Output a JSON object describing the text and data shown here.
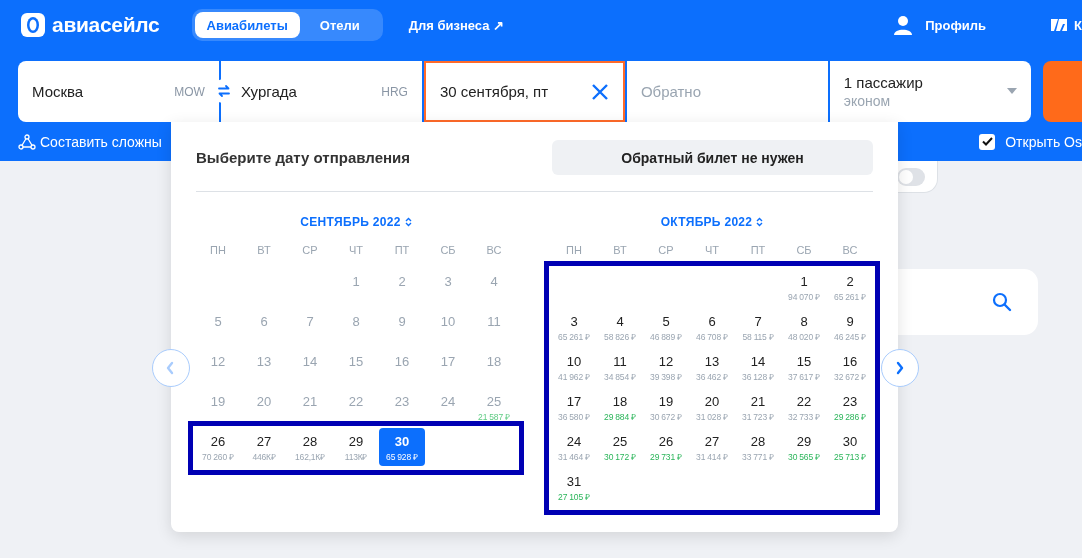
{
  "header": {
    "logo": "авиасейлс",
    "tabs": [
      {
        "label": "Авиабилеты",
        "selected": true
      },
      {
        "label": "Отели",
        "selected": false
      }
    ],
    "business_link": "Для бизнеса ↗",
    "profile": "Профиль",
    "cut_link": "К"
  },
  "search": {
    "origin": {
      "city": "Москва",
      "code": "MOW"
    },
    "destination": {
      "city": "Хургада",
      "code": "HRG"
    },
    "depart": {
      "value": "30 сентября, пт"
    },
    "return": {
      "placeholder": "Обратно"
    },
    "passengers": {
      "count": "1 пассажир",
      "class": "эконом"
    }
  },
  "options": {
    "complex_route": "Составить сложны",
    "open_checkbox": {
      "label": "Открыть Os",
      "checked": true
    }
  },
  "background": {
    "toggle": {
      "on": false
    }
  },
  "picker": {
    "title": "Выберите дату отправления",
    "no_return_button": "Обратный билет не нужен",
    "prev_button": {
      "disabled": true
    },
    "next_button": {
      "disabled": false
    },
    "months": [
      {
        "title": "СЕНТЯБРЬ 2022",
        "weekdays": [
          "ПН",
          "ВТ",
          "СР",
          "ЧТ",
          "ПТ",
          "СБ",
          "ВС"
        ],
        "weeks": [
          {
            "highlighted": false,
            "days": [
              {
                "kind": "blank"
              },
              {
                "kind": "blank"
              },
              {
                "kind": "blank"
              },
              {
                "kind": "day",
                "day": "1",
                "disabled": true,
                "selected": false
              },
              {
                "kind": "day",
                "day": "2",
                "disabled": true,
                "selected": false
              },
              {
                "kind": "day",
                "day": "3",
                "disabled": true,
                "selected": false
              },
              {
                "kind": "day",
                "day": "4",
                "disabled": true,
                "selected": false
              }
            ]
          },
          {
            "highlighted": false,
            "days": [
              {
                "kind": "day",
                "day": "5",
                "disabled": true,
                "selected": false
              },
              {
                "kind": "day",
                "day": "6",
                "disabled": true,
                "selected": false
              },
              {
                "kind": "day",
                "day": "7",
                "disabled": true,
                "selected": false
              },
              {
                "kind": "day",
                "day": "8",
                "disabled": true,
                "selected": false
              },
              {
                "kind": "day",
                "day": "9",
                "disabled": true,
                "selected": false
              },
              {
                "kind": "day",
                "day": "10",
                "disabled": true,
                "selected": false
              },
              {
                "kind": "day",
                "day": "11",
                "disabled": true,
                "selected": false
              }
            ]
          },
          {
            "highlighted": false,
            "days": [
              {
                "kind": "day",
                "day": "12",
                "disabled": true,
                "selected": false
              },
              {
                "kind": "day",
                "day": "13",
                "disabled": true,
                "selected": false
              },
              {
                "kind": "day",
                "day": "14",
                "disabled": true,
                "selected": false
              },
              {
                "kind": "day",
                "day": "15",
                "disabled": true,
                "selected": false
              },
              {
                "kind": "day",
                "day": "16",
                "disabled": true,
                "selected": false
              },
              {
                "kind": "day",
                "day": "17",
                "disabled": true,
                "selected": false
              },
              {
                "kind": "day",
                "day": "18",
                "disabled": true,
                "selected": false
              }
            ]
          },
          {
            "highlighted": false,
            "days": [
              {
                "kind": "day",
                "day": "19",
                "disabled": true,
                "selected": false
              },
              {
                "kind": "day",
                "day": "20",
                "disabled": true,
                "selected": false
              },
              {
                "kind": "day",
                "day": "21",
                "disabled": true,
                "selected": false
              },
              {
                "kind": "day",
                "day": "22",
                "disabled": true,
                "selected": false
              },
              {
                "kind": "day",
                "day": "23",
                "disabled": true,
                "selected": false
              },
              {
                "kind": "day",
                "day": "24",
                "disabled": true,
                "selected": false
              },
              {
                "kind": "day",
                "day": "25",
                "disabled": true,
                "selected": false,
                "price": "21 587 ₽",
                "cheap": true
              }
            ]
          },
          {
            "highlighted": true,
            "days": [
              {
                "kind": "day",
                "day": "26",
                "disabled": false,
                "selected": false,
                "price": "70 260 ₽",
                "cheap": false
              },
              {
                "kind": "day",
                "day": "27",
                "disabled": false,
                "selected": false,
                "price": "446К₽",
                "cheap": false
              },
              {
                "kind": "day",
                "day": "28",
                "disabled": false,
                "selected": false,
                "price": "162,1К₽",
                "cheap": false
              },
              {
                "kind": "day",
                "day": "29",
                "disabled": false,
                "selected": false,
                "price": "113К₽",
                "cheap": false
              },
              {
                "kind": "day",
                "day": "30",
                "disabled": false,
                "selected": true,
                "price": "65 928 ₽",
                "cheap": false
              },
              {
                "kind": "blank"
              },
              {
                "kind": "blank"
              }
            ]
          }
        ]
      },
      {
        "title": "ОКТЯБРЬ 2022",
        "weekdays": [
          "ПН",
          "ВТ",
          "СР",
          "ЧТ",
          "ПТ",
          "СБ",
          "ВС"
        ],
        "weeks": [
          {
            "highlighted": true,
            "days": [
              {
                "kind": "blank"
              },
              {
                "kind": "blank"
              },
              {
                "kind": "blank"
              },
              {
                "kind": "blank"
              },
              {
                "kind": "blank"
              },
              {
                "kind": "day",
                "day": "1",
                "disabled": false,
                "selected": false,
                "price": "94 070 ₽",
                "cheap": false
              },
              {
                "kind": "day",
                "day": "2",
                "disabled": false,
                "selected": false,
                "price": "65 261 ₽",
                "cheap": false
              }
            ]
          },
          {
            "highlighted": true,
            "days": [
              {
                "kind": "day",
                "day": "3",
                "disabled": false,
                "selected": false,
                "price": "65 261 ₽",
                "cheap": false
              },
              {
                "kind": "day",
                "day": "4",
                "disabled": false,
                "selected": false,
                "price": "58 826 ₽",
                "cheap": false
              },
              {
                "kind": "day",
                "day": "5",
                "disabled": false,
                "selected": false,
                "price": "46 889 ₽",
                "cheap": false
              },
              {
                "kind": "day",
                "day": "6",
                "disabled": false,
                "selected": false,
                "price": "46 708 ₽",
                "cheap": false
              },
              {
                "kind": "day",
                "day": "7",
                "disabled": false,
                "selected": false,
                "price": "58 115 ₽",
                "cheap": false
              },
              {
                "kind": "day",
                "day": "8",
                "disabled": false,
                "selected": false,
                "price": "48 020 ₽",
                "cheap": false
              },
              {
                "kind": "day",
                "day": "9",
                "disabled": false,
                "selected": false,
                "price": "46 245 ₽",
                "cheap": false
              }
            ]
          },
          {
            "highlighted": true,
            "days": [
              {
                "kind": "day",
                "day": "10",
                "disabled": false,
                "selected": false,
                "price": "41 962 ₽",
                "cheap": false
              },
              {
                "kind": "day",
                "day": "11",
                "disabled": false,
                "selected": false,
                "price": "34 854 ₽",
                "cheap": false
              },
              {
                "kind": "day",
                "day": "12",
                "disabled": false,
                "selected": false,
                "price": "39 398 ₽",
                "cheap": false
              },
              {
                "kind": "day",
                "day": "13",
                "disabled": false,
                "selected": false,
                "price": "36 462 ₽",
                "cheap": false
              },
              {
                "kind": "day",
                "day": "14",
                "disabled": false,
                "selected": false,
                "price": "36 128 ₽",
                "cheap": false
              },
              {
                "kind": "day",
                "day": "15",
                "disabled": false,
                "selected": false,
                "price": "37 617 ₽",
                "cheap": false
              },
              {
                "kind": "day",
                "day": "16",
                "disabled": false,
                "selected": false,
                "price": "32 672 ₽",
                "cheap": false
              }
            ]
          },
          {
            "highlighted": true,
            "days": [
              {
                "kind": "day",
                "day": "17",
                "disabled": false,
                "selected": false,
                "price": "36 580 ₽",
                "cheap": false
              },
              {
                "kind": "day",
                "day": "18",
                "disabled": false,
                "selected": false,
                "price": "29 884 ₽",
                "cheap": true
              },
              {
                "kind": "day",
                "day": "19",
                "disabled": false,
                "selected": false,
                "price": "30 672 ₽",
                "cheap": false
              },
              {
                "kind": "day",
                "day": "20",
                "disabled": false,
                "selected": false,
                "price": "31 028 ₽",
                "cheap": false
              },
              {
                "kind": "day",
                "day": "21",
                "disabled": false,
                "selected": false,
                "price": "31 723 ₽",
                "cheap": false
              },
              {
                "kind": "day",
                "day": "22",
                "disabled": false,
                "selected": false,
                "price": "32 733 ₽",
                "cheap": false
              },
              {
                "kind": "day",
                "day": "23",
                "disabled": false,
                "selected": false,
                "price": "29 286 ₽",
                "cheap": true
              }
            ]
          },
          {
            "highlighted": true,
            "days": [
              {
                "kind": "day",
                "day": "24",
                "disabled": false,
                "selected": false,
                "price": "31 464 ₽",
                "cheap": false
              },
              {
                "kind": "day",
                "day": "25",
                "disabled": false,
                "selected": false,
                "price": "30 172 ₽",
                "cheap": true
              },
              {
                "kind": "day",
                "day": "26",
                "disabled": false,
                "selected": false,
                "price": "29 731 ₽",
                "cheap": true
              },
              {
                "kind": "day",
                "day": "27",
                "disabled": false,
                "selected": false,
                "price": "31 414 ₽",
                "cheap": false
              },
              {
                "kind": "day",
                "day": "28",
                "disabled": false,
                "selected": false,
                "price": "33 771 ₽",
                "cheap": false
              },
              {
                "kind": "day",
                "day": "29",
                "disabled": false,
                "selected": false,
                "price": "30 565 ₽",
                "cheap": true
              },
              {
                "kind": "day",
                "day": "30",
                "disabled": false,
                "selected": false,
                "price": "25 713 ₽",
                "cheap": true
              }
            ]
          },
          {
            "highlighted": true,
            "days": [
              {
                "kind": "day",
                "day": "31",
                "disabled": false,
                "selected": false,
                "price": "27 105 ₽",
                "cheap": true
              },
              {
                "kind": "blank"
              },
              {
                "kind": "blank"
              },
              {
                "kind": "blank"
              },
              {
                "kind": "blank"
              },
              {
                "kind": "blank"
              },
              {
                "kind": "blank"
              }
            ]
          }
        ]
      }
    ]
  }
}
